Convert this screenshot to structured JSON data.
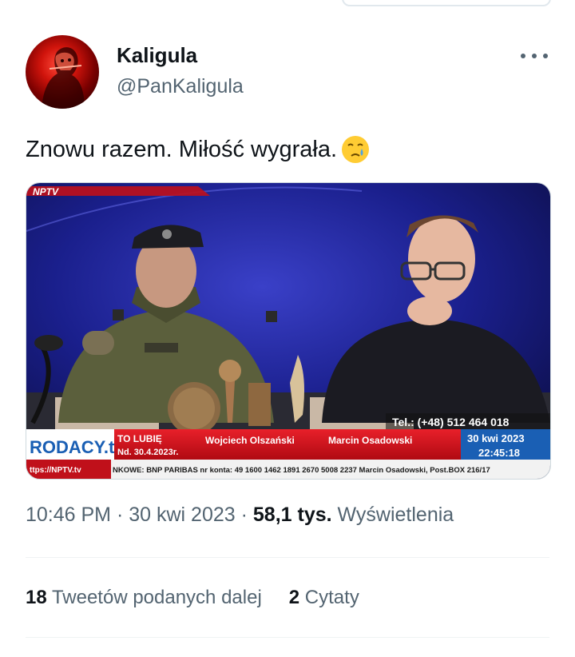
{
  "author": {
    "display_name": "Kaligula",
    "handle": "@PanKaligula"
  },
  "tweet": {
    "text": "Znowu razem. Miłość wygrała.",
    "emoji": "crying-face-emoji"
  },
  "media": {
    "channel_logo": "NPTV",
    "brand": "RODACY.tv",
    "program_title": "TO LUBIĘ",
    "program_date": "Nd. 30.4.2023r.",
    "guest_1": "Wojciech Olszański",
    "guest_2": "Marcin Osadowski",
    "phone": "Tel.: (+48) 512 464 018",
    "date": "30 kwi 2023",
    "time": "22:45:18",
    "ticker_left": "ttps://NPTV.tv",
    "ticker_text": "NKOWE: BNP PARIBAS nr konta: 49 1600 1462 1891 2670 5008 2237 Marcin Osadowski, Post.BOX 216/17"
  },
  "meta": {
    "time": "10:46 PM",
    "sep1": " · ",
    "date": "30 kwi 2023",
    "sep2": " · ",
    "views_count": "58,1 tys.",
    "views_label": " Wyświetlenia"
  },
  "stats": {
    "retweets_count": "18",
    "retweets_label": " Tweetów podanych dalej",
    "quotes_count": "2",
    "quotes_label": " Cytaty"
  },
  "colors": {
    "text": "#0f1419",
    "secondary": "#536471",
    "tv_red": "#d6101a",
    "tv_blue": "#1a5fb4",
    "studio_bg": "#1a1f8c"
  }
}
